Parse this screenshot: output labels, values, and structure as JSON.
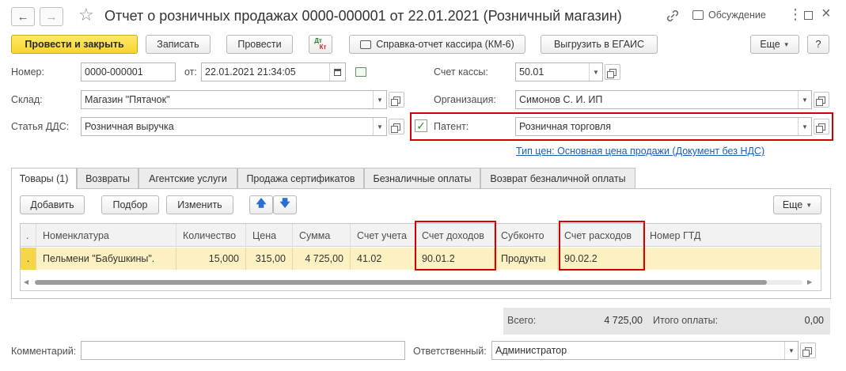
{
  "window": {
    "title": "Отчет о розничных продажах 0000-000001 от 22.01.2021 (Розничный магазин)",
    "discussion_label": "Обсуждение"
  },
  "toolbar": {
    "post_close": "Провести и закрыть",
    "save": "Записать",
    "post": "Провести",
    "dt_kt_top": "Дт",
    "dt_kt_bottom": "Кт",
    "cashier_report": "Справка-отчет кассира (КМ-6)",
    "egais": "Выгрузить в ЕГАИС",
    "more": "Еще",
    "help": "?"
  },
  "header": {
    "number_label": "Номер:",
    "number_value": "0000-000001",
    "date_label": "от:",
    "date_value": "22.01.2021 21:34:05",
    "cash_account_label": "Счет кассы:",
    "cash_account_value": "50.01",
    "warehouse_label": "Склад:",
    "warehouse_value": "Магазин \"Пятачок\"",
    "org_label": "Организация:",
    "org_value": "Симонов С. И. ИП",
    "dds_label": "Статья ДДС:",
    "dds_value": "Розничная выручка",
    "patent_label": "Патент:",
    "patent_value": "Розничная торговля",
    "patent_checked": true,
    "price_type_link": "Тип цен: Основная цена продажи (Документ без НДС)"
  },
  "tabs": [
    {
      "label": "Товары (1)",
      "active": true
    },
    {
      "label": "Возвраты",
      "active": false
    },
    {
      "label": "Агентские услуги",
      "active": false
    },
    {
      "label": "Продажа сертификатов",
      "active": false
    },
    {
      "label": "Безналичные оплаты",
      "active": false
    },
    {
      "label": "Возврат безналичной оплаты",
      "active": false
    }
  ],
  "table_toolbar": {
    "add": "Добавить",
    "pick": "Подбор",
    "change": "Изменить",
    "more": "Еще"
  },
  "table": {
    "columns": [
      "Номенклатура",
      "Количество",
      "Цена",
      "Сумма",
      "Счет учета",
      "Счет доходов",
      "Субконто",
      "Счет расходов",
      "Номер ГТД"
    ],
    "rows": [
      {
        "marker": ".",
        "item": "Пельмени \"Бабушкины\".",
        "qty": "15,000",
        "price": "315,00",
        "sum": "4 725,00",
        "account": "41.02",
        "income_account": "90.01.2",
        "subconto": "Продукты",
        "expense_account": "90.02.2",
        "gtd": ""
      }
    ]
  },
  "totals": {
    "total_label": "Всего:",
    "total_value": "4 725,00",
    "paid_label": "Итого оплаты:",
    "paid_value": "0,00"
  },
  "footer": {
    "comment_label": "Комментарий:",
    "comment_value": "",
    "responsible_label": "Ответственный:",
    "responsible_value": "Администратор"
  },
  "colors": {
    "accent_yellow": "#f7d52d",
    "highlight_red": "#d40000",
    "link_blue": "#1a5fb4",
    "row_selected": "#fbf1c2"
  }
}
